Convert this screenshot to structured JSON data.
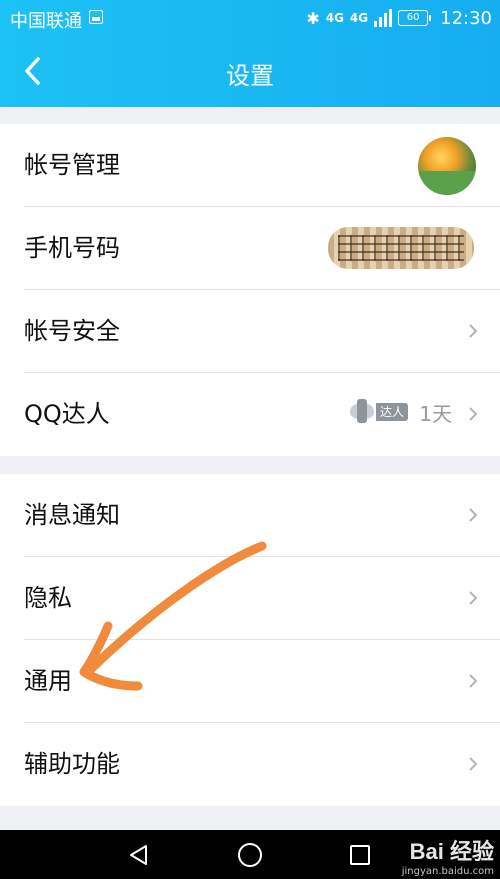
{
  "status_bar": {
    "carrier": "中国联通",
    "network": "4G",
    "network2": "4G",
    "battery": "60",
    "time": "12:30"
  },
  "header": {
    "title": "设置"
  },
  "group1": {
    "account_manage": "帐号管理",
    "phone": "手机号码",
    "account_security": "帐号安全",
    "qq_expert": "QQ达人",
    "qq_expert_badge": "达人",
    "qq_expert_days": "1天"
  },
  "group2": {
    "notifications": "消息通知",
    "privacy": "隐私",
    "general": "通用",
    "accessibility": "辅助功能"
  },
  "watermark": {
    "brand": "Bai 经验",
    "url": "jingyan.baidu.com"
  },
  "colors": {
    "header": "#16aef1",
    "annotation_arrow": "#f08a3c"
  }
}
